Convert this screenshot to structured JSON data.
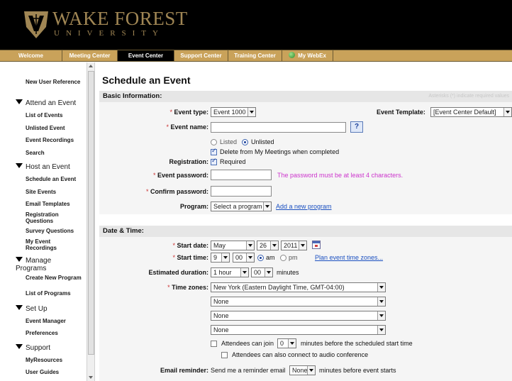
{
  "brand": {
    "name": "WAKE FOREST",
    "subname": "UNIVERSITY"
  },
  "tabs": [
    {
      "label": "Welcome"
    },
    {
      "label": "Meeting Center"
    },
    {
      "label": "Event Center"
    },
    {
      "label": "Support Center"
    },
    {
      "label": "Training Center"
    },
    {
      "label": "My WebEx"
    }
  ],
  "sidebar": {
    "new_user_reference": "New User Reference",
    "attend_head": "Attend an Event",
    "list_of_events": "List of Events",
    "unlisted_event": "Unlisted Event",
    "event_recordings": "Event Recordings",
    "search": "Search",
    "host_head": "Host an Event",
    "schedule_an_event": "Schedule an Event",
    "site_events": "Site Events",
    "email_templates": "Email Templates",
    "registration_questions": "Registration Questions",
    "survey_questions": "Survey Questions",
    "my_event_recordings": "My Event Recordings",
    "manage_head": "Manage Programs",
    "create_new_program": "Create New Program",
    "list_of_programs": "List of Programs",
    "setup_head": "Set Up",
    "event_manager": "Event Manager",
    "preferences": "Preferences",
    "support_head": "Support",
    "myresources": "MyResources",
    "user_guides": "User Guides"
  },
  "page": {
    "title": "Schedule an Event"
  },
  "basic": {
    "header": "Basic Information:",
    "required_note": "Asterisks (*) indicate required values",
    "event_type_label": "Event type:",
    "event_type_value": "Event 1000",
    "event_template_label": "Event Template:",
    "event_template_value": "[Event Center Default]",
    "event_name_label": "Event name:",
    "event_name_value": "",
    "help_glyph": "?",
    "listed": "Listed",
    "unlisted": "Unlisted",
    "delete_option": "Delete from My Meetings when completed",
    "registration_label": "Registration:",
    "registration_required": "Required",
    "password_label": "Event password:",
    "password_hint": "The password must be at least 4 characters.",
    "confirm_label": "Confirm password:",
    "program_label": "Program:",
    "program_value": "Select a program",
    "add_program_link": "Add a new program"
  },
  "datetime": {
    "header": "Date & Time:",
    "start_date_label": "Start date:",
    "month": "May",
    "day": "26",
    "year": "2011",
    "start_time_label": "Start time:",
    "hour": "9",
    "minute": "00",
    "am": "am",
    "pm": "pm",
    "plan_link": "Plan event time zones...",
    "duration_label": "Estimated duration:",
    "duration_hours": "1 hour",
    "duration_minutes": "00",
    "minutes_word": "minutes",
    "timezones_label": "Time zones:",
    "tz1": "New York (Eastern Daylight Time, GMT-04:00)",
    "tz2": "None",
    "tz3": "None",
    "tz4": "None",
    "join_prefix": "Attendees can join",
    "join_value": "0",
    "join_suffix": "minutes before the scheduled start time",
    "audio_option": "Attendees can also connect to audio conference",
    "reminder_label": "Email reminder:",
    "reminder_prefix": "Send me a reminder email",
    "reminder_value": "None",
    "reminder_suffix": "minutes before event starts"
  },
  "colors": {
    "brand_gold": "#a08654",
    "tab_gold": "#c9a25a",
    "link_blue": "#1a4fc0",
    "hint_magenta": "#cc33cc"
  },
  "required_marker": "*"
}
